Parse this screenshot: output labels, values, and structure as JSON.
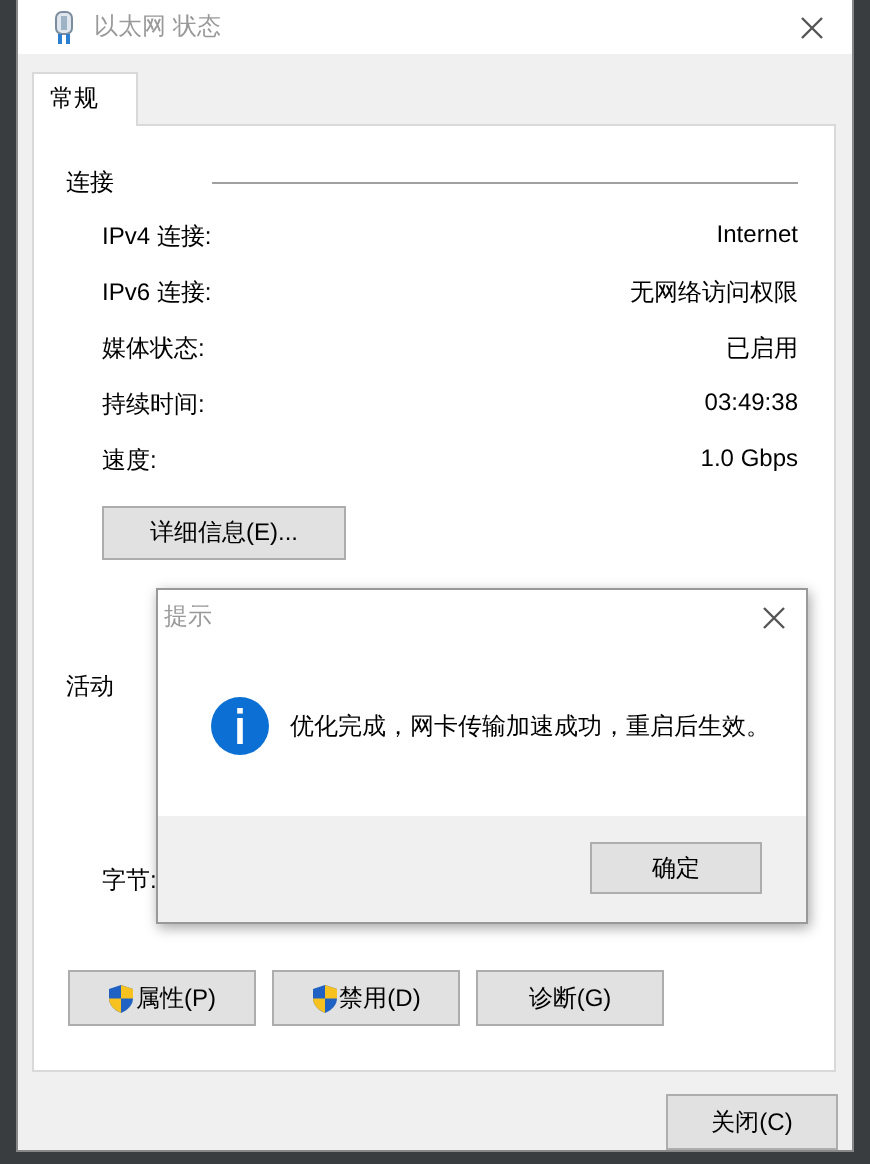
{
  "window": {
    "title": "以太网 状态"
  },
  "tabs": [
    {
      "label": "常规",
      "selected": true
    }
  ],
  "connection": {
    "heading": "连接",
    "rows": [
      {
        "label": "IPv4 连接:",
        "value": "Internet"
      },
      {
        "label": "IPv6 连接:",
        "value": "无网络访问权限"
      },
      {
        "label": "媒体状态:",
        "value": "已启用"
      },
      {
        "label": "持续时间:",
        "value": "03:49:38"
      },
      {
        "label": "速度:",
        "value": "1.0 Gbps"
      }
    ],
    "details_button": "详细信息(E)..."
  },
  "activity": {
    "heading": "活动",
    "bytes_label": "字节:"
  },
  "buttons": [
    {
      "label": "属性(P)",
      "shield": true
    },
    {
      "label": "禁用(D)",
      "shield": true
    },
    {
      "label": "诊断(G)",
      "shield": false
    }
  ],
  "close_button": "关闭(C)",
  "dialog": {
    "title": "提示",
    "message": "优化完成，网卡传输加速成功，重启后生效。",
    "ok_button": "确定"
  }
}
